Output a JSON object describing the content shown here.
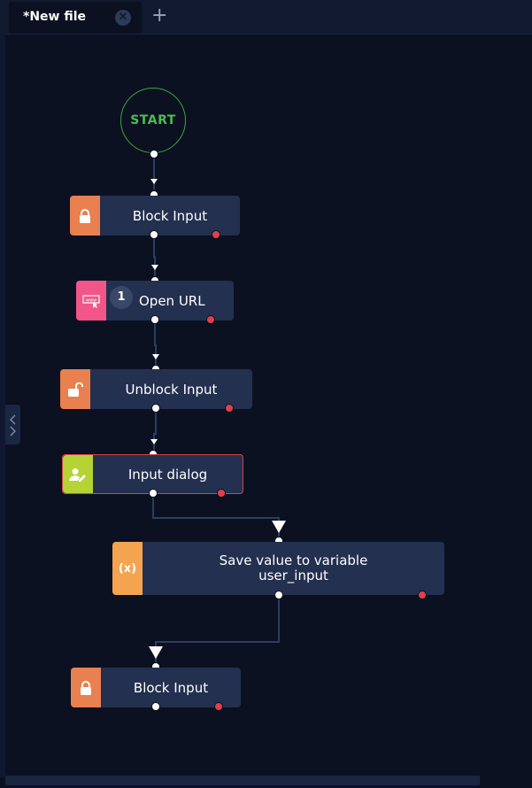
{
  "tabs": [
    {
      "title": "*New file",
      "close_icon": "close-circle-icon"
    }
  ],
  "add_tab_icon": "plus-icon",
  "start_label": "START",
  "nodes": [
    {
      "label": "Block Input",
      "icon": "lock-icon",
      "color": "#e8804f"
    },
    {
      "label": "Open URL",
      "badge": "1",
      "icon": "www-cursor-icon",
      "color": "#f2558a"
    },
    {
      "label": "Unblock Input",
      "icon": "unlock-icon",
      "color": "#e8804f"
    },
    {
      "label": "Input dialog",
      "icon": "user-edit-icon",
      "color": "#b5d334",
      "selected": true
    },
    {
      "label": "Save value to variable",
      "label_line2": "user_input",
      "icon": "variable-icon",
      "icon_text": "(x)",
      "color": "#f4a451"
    },
    {
      "label": "Block Input",
      "icon": "lock-icon",
      "color": "#e8804f"
    }
  ],
  "colors": {
    "canvas": "#0b1120",
    "node": "#23304f",
    "start": "#4dbb55",
    "error_port": "#e0404a",
    "selected_border": "#d9434b"
  }
}
